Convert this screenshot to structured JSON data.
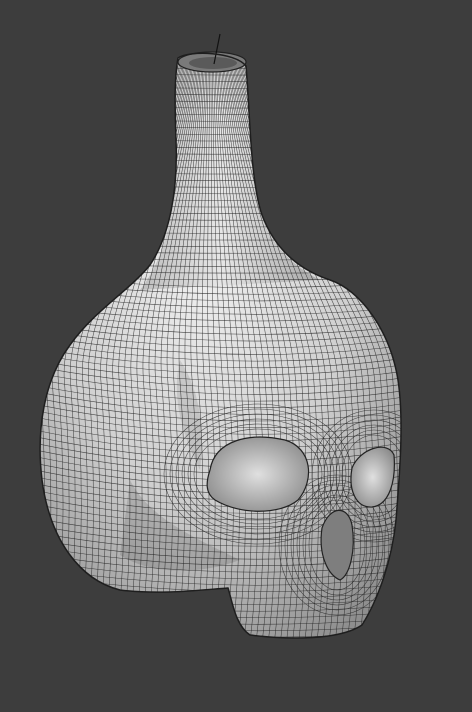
{
  "viewport": {
    "background_color": "#3d3d3d",
    "mesh_fill_color": "#d8d8d8",
    "mesh_shadow_color": "#9a9a9a",
    "wire_color": "#222222",
    "object_icon": "wireframe-skull-bottle-model",
    "object_origin_marker": "object-origin-line-icon"
  }
}
